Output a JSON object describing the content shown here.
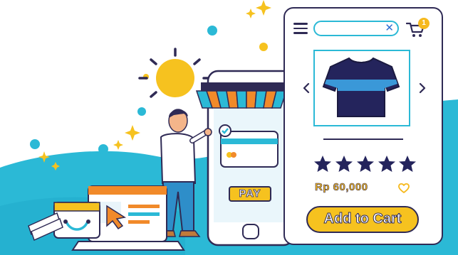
{
  "colors": {
    "navy": "#2f2a55",
    "cyan": "#2bb9d6",
    "yellow": "#f6c21f",
    "orange": "#f18a2a",
    "white": "#ffffff"
  },
  "illustration": {
    "sun_icon": "sun-icon",
    "cloud_wave": "cyan-wave"
  },
  "phone": {
    "pay_label": "PAY"
  },
  "product_card": {
    "menu_icon": "hamburger-icon",
    "search": {
      "placeholder": ""
    },
    "cart_badge": "1",
    "product_image": "tshirt-icon",
    "rating": 5,
    "price": "Rp 60,000",
    "add_to_cart_label": "Add to Cart"
  }
}
